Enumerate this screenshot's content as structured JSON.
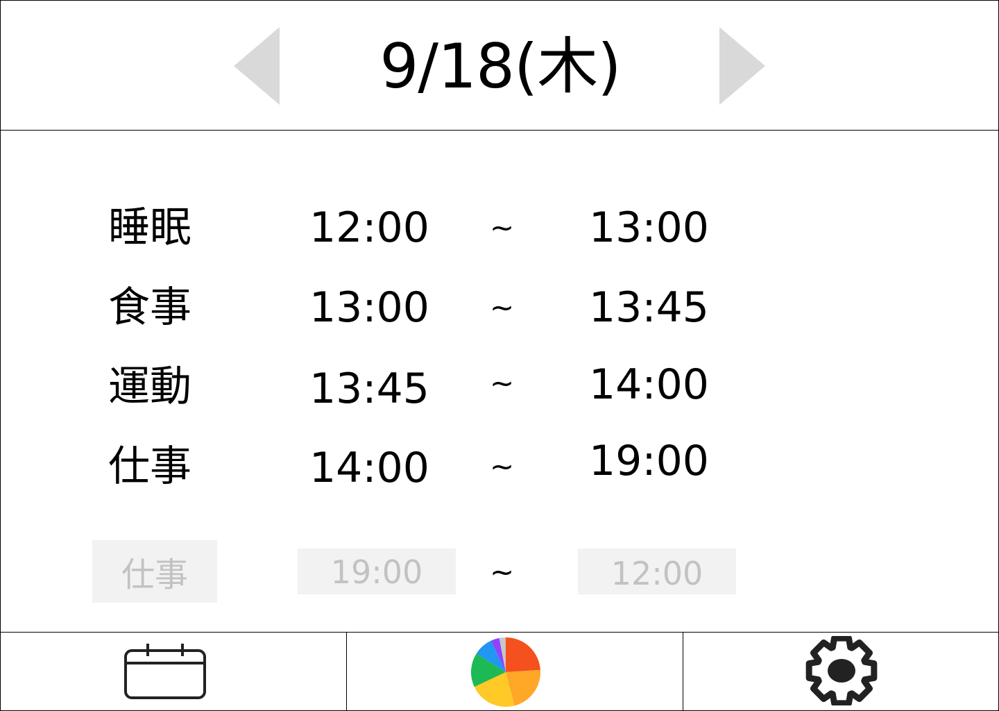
{
  "header": {
    "date": "9/18(木)",
    "prev_icon": "triangle-left-icon",
    "next_icon": "triangle-right-icon"
  },
  "schedule": [
    {
      "category": "睡眠",
      "start": "12:00",
      "separator": "~",
      "end": "13:00"
    },
    {
      "category": "食事",
      "start": "13:00",
      "separator": "~",
      "end": "13:45"
    },
    {
      "category": "運動",
      "start": "13:45",
      "separator": "~",
      "end": "14:00"
    },
    {
      "category": "仕事",
      "start": "14:00",
      "separator": "~",
      "end": "19:00"
    }
  ],
  "new_entry": {
    "category": "仕事",
    "start": "19:00",
    "separator": "~",
    "end": "12:00"
  },
  "footer": {
    "tabs": [
      {
        "icon": "calendar-icon"
      },
      {
        "icon": "pie-chart-icon"
      },
      {
        "icon": "gear-icon"
      }
    ],
    "pie_colors": [
      "#f4511e",
      "#ffa726",
      "#ffca28",
      "#1db954",
      "#2196f3",
      "#8e44ff",
      "#c7c7c7"
    ]
  }
}
